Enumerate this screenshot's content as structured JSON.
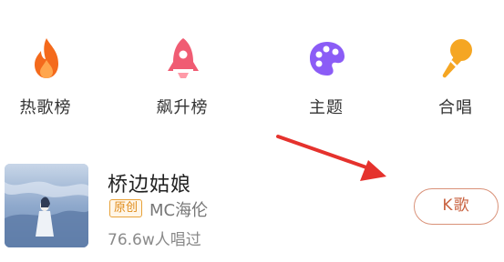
{
  "nav": {
    "items": [
      {
        "label": "热歌榜",
        "icon": "flame-icon",
        "color": "#f46a1c"
      },
      {
        "label": "飙升榜",
        "icon": "rocket-icon",
        "color": "#f05c73"
      },
      {
        "label": "主题",
        "icon": "palette-icon",
        "color": "#8b5cf6"
      },
      {
        "label": "合唱",
        "icon": "microphone-icon",
        "color": "#f5a623"
      }
    ]
  },
  "song": {
    "title": "桥边姑娘",
    "badge": "原创",
    "artist": "MC海伦",
    "sing_count": "76.6w人唱过",
    "action_label": "K歌"
  },
  "colors": {
    "annotation_arrow": "#e5322d",
    "k_button_border": "#d99178",
    "badge_border": "#e8a23a"
  }
}
